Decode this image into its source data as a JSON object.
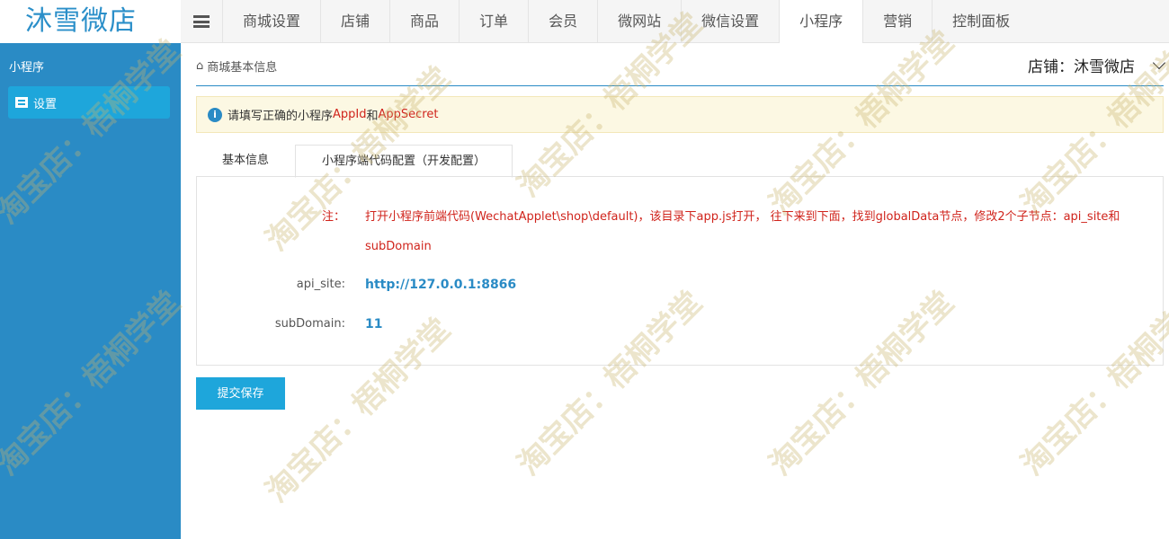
{
  "app": {
    "logo": "沐雪微店"
  },
  "nav": {
    "items": [
      {
        "label": "商城设置"
      },
      {
        "label": "店铺"
      },
      {
        "label": "商品"
      },
      {
        "label": "订单"
      },
      {
        "label": "会员"
      },
      {
        "label": "微网站"
      },
      {
        "label": "微信设置"
      },
      {
        "label": "小程序"
      },
      {
        "label": "营销"
      },
      {
        "label": "控制面板"
      }
    ],
    "active_index": 7
  },
  "sidebar": {
    "title": "小程序",
    "items": [
      {
        "label": "设置",
        "icon": "list-icon"
      }
    ]
  },
  "breadcrumb": {
    "icon": "home-icon",
    "label": "商城基本信息"
  },
  "shop_selector": {
    "label": "店铺：",
    "value": "沐雪微店",
    "icon": "chevron-down-icon"
  },
  "alert": {
    "icon": "info-icon",
    "prefix": "请填写正确的小程序 ",
    "appid": "AppId",
    "and": " 和 ",
    "appsecret": "AppSecret"
  },
  "tabs": [
    {
      "label": "基本信息"
    },
    {
      "label": "小程序端代码配置（开发配置）"
    }
  ],
  "form": {
    "note_label": "注：",
    "note_text": "打开小程序前端代码(WechatApplet\\shop\\default)，该目录下app.js打开， 往下来到下面，找到globalData节点，修改2个子节点：api_site和subDomain",
    "api_site_label": "api_site:",
    "api_site_value": "http://127.0.0.1:8866",
    "subdomain_label": "subDomain:",
    "subdomain_value": "11"
  },
  "save_button": {
    "label": "提交保存"
  },
  "watermark": {
    "text": "淘宝店：梧桐学堂"
  },
  "colors": {
    "sidebar": "#2a8bc5",
    "accent": "#1ea6db",
    "alert_red": "#d0241c"
  }
}
